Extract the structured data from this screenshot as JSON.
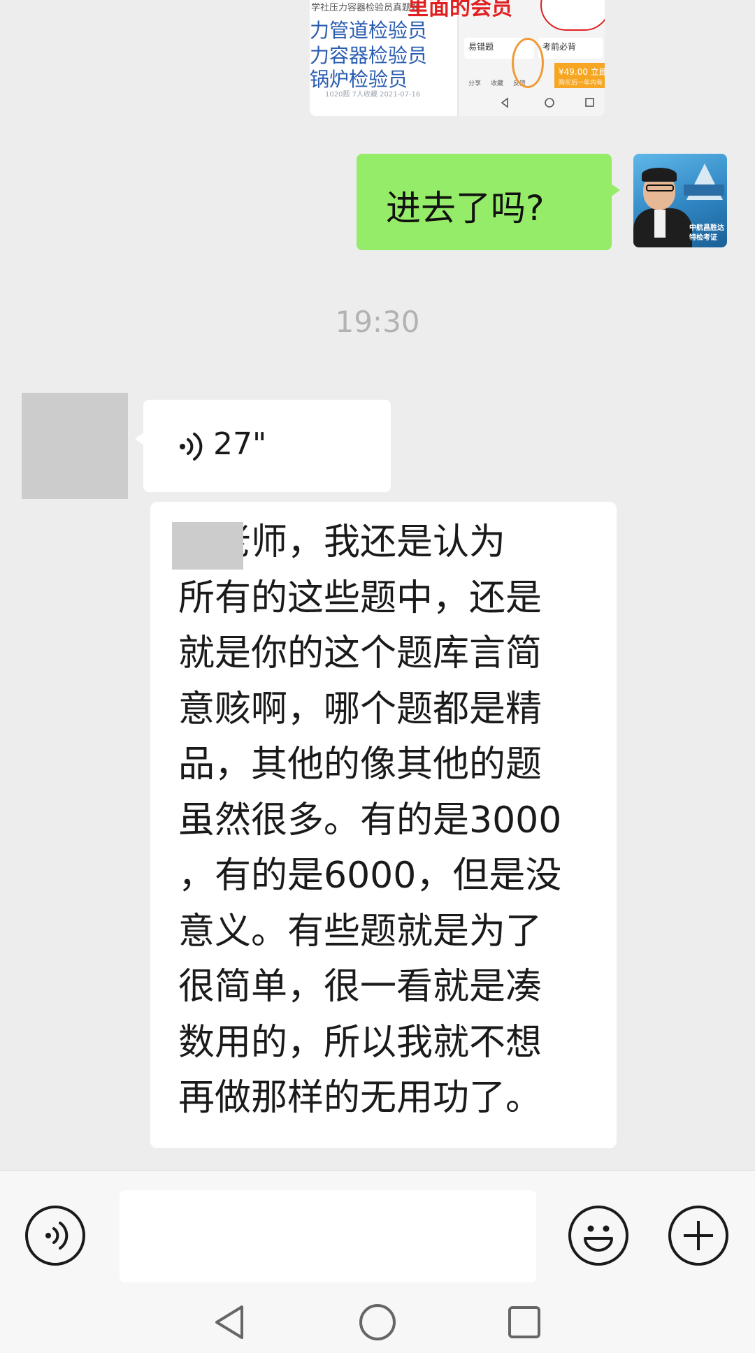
{
  "shared_image": {
    "header": "学社压力容器检验员真题题",
    "meta_top": "",
    "lines": [
      "力管道检验员",
      "力容器检验员",
      "锅炉检验员"
    ],
    "meta_bottom": "1020题   7人收藏   2021-07-16",
    "red_caption": "里面的会员",
    "cards": [
      "易错题",
      "考前必背"
    ],
    "price": "¥49.00 立即",
    "price_note": "购买后一年内有",
    "icons": [
      "分享",
      "收藏",
      "反馈"
    ]
  },
  "messages": {
    "outgoing_text": "进去了吗?",
    "timestamp": "19:30",
    "voice_duration": "27\"",
    "incoming_lines": [
      "静老师，我还是认为",
      "所有的这些题中，还是",
      "就是你的这个题库言简",
      "意赅啊，哪个题都是精",
      "品，其他的像其他的题",
      "虽然很多。有的是3000",
      "，有的是6000，但是没",
      "意义。有些题就是为了",
      "很简单，很一看就是凑",
      "数用的，所以我就不想",
      "再做那样的无用功了。"
    ]
  },
  "avatar_me": {
    "caption_line1": "中航昌胜达",
    "caption_line2": "特检考证"
  },
  "input_bar": {
    "placeholder": ""
  }
}
